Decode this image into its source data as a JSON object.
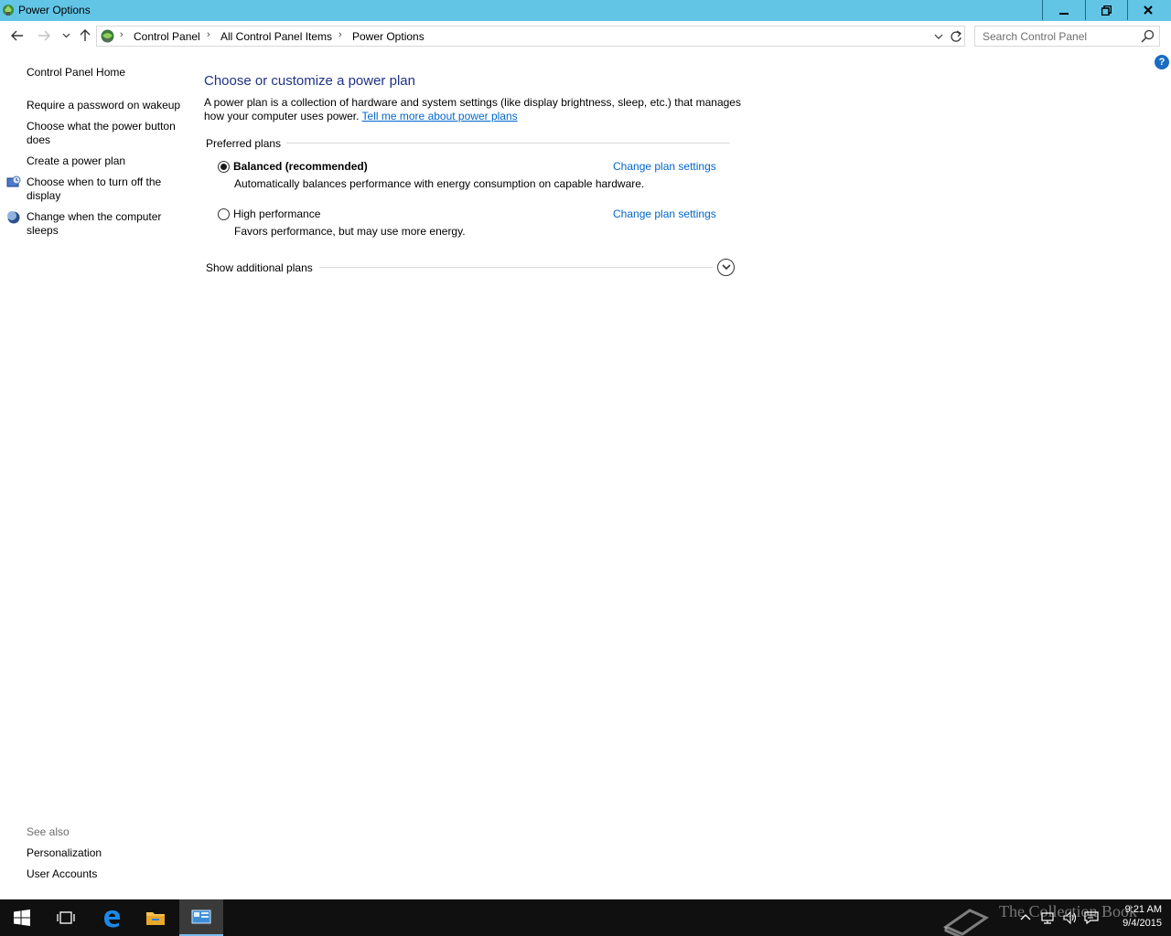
{
  "window": {
    "title": "Power Options",
    "colors": {
      "titlebar": "#62c5e6",
      "link": "#0066cc",
      "heading": "#1e3287"
    }
  },
  "address": {
    "crumbs": [
      "Control Panel",
      "All Control Panel Items",
      "Power Options"
    ]
  },
  "search": {
    "placeholder": "Search Control Panel"
  },
  "left_pane": {
    "home": "Control Panel Home",
    "links": [
      "Require a password on wakeup",
      "Choose what the power button does",
      "Create a power plan",
      "Choose when to turn off the display",
      "Change when the computer sleeps"
    ],
    "see_also_label": "See also",
    "see_also": [
      "Personalization",
      "User Accounts"
    ]
  },
  "main": {
    "heading": "Choose or customize a power plan",
    "description": "A power plan is a collection of hardware and system settings (like display brightness, sleep, etc.) that manages how your computer uses power.",
    "description_link": "Tell me more about power plans",
    "preferred_label": "Preferred plans",
    "plans": [
      {
        "name": "Balanced (recommended)",
        "description": "Automatically balances performance with energy consumption on capable hardware.",
        "link": "Change plan settings",
        "selected": true
      },
      {
        "name": "High performance",
        "description": "Favors performance, but may use more energy.",
        "link": "Change plan settings",
        "selected": false
      }
    ],
    "more_plans": "Show additional plans"
  },
  "help": {
    "label": "?"
  },
  "taskbar": {
    "items": [
      "start-icon",
      "task-view-icon",
      "edge-icon",
      "file-explorer-icon",
      "control-panel-icon"
    ],
    "watermark": "The Collection Book",
    "time": "9:21 AM",
    "date": "9/4/2015"
  }
}
